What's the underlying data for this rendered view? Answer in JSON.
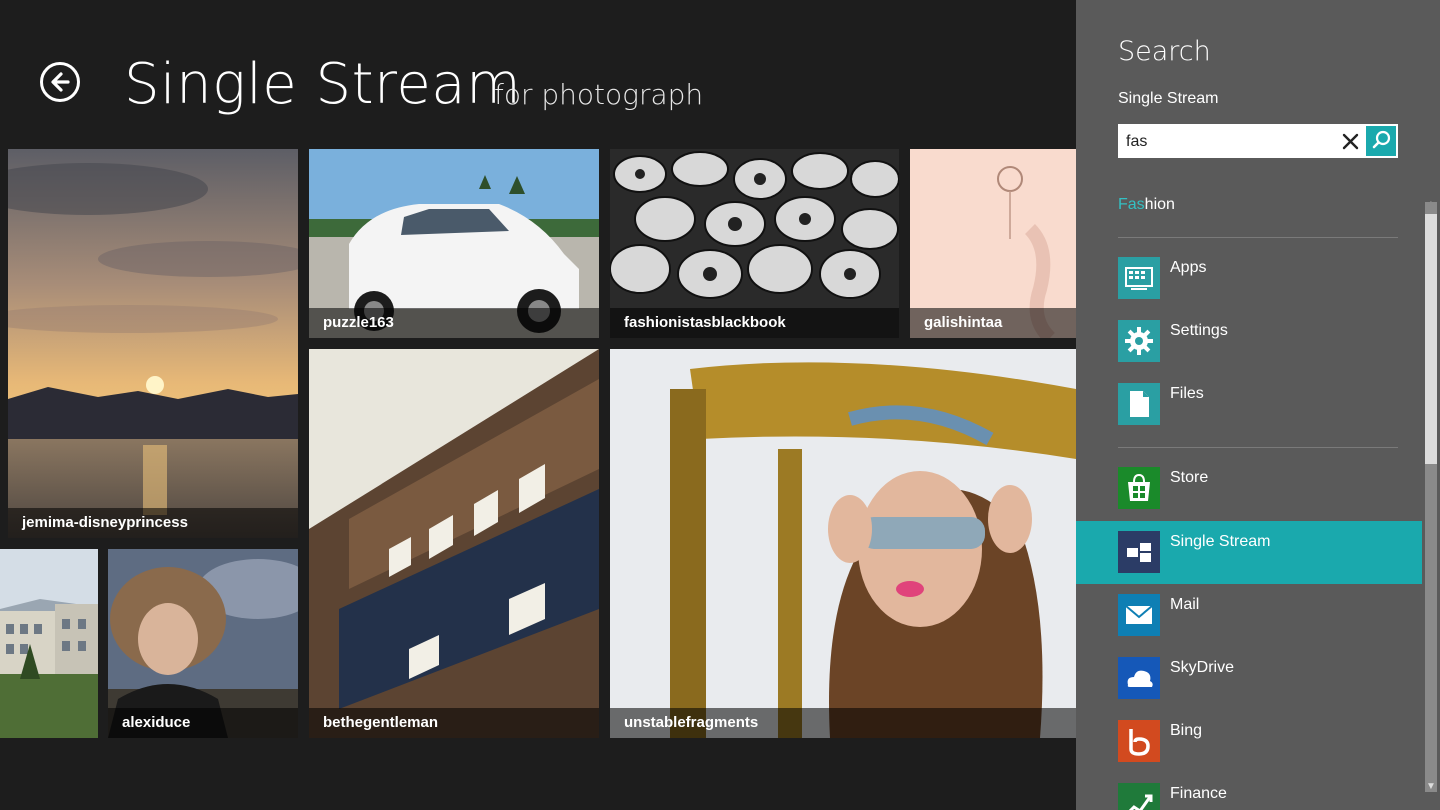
{
  "header": {
    "app_title": "Single Stream",
    "subtitle": "for photograph"
  },
  "tiles": [
    {
      "caption": "jemima-disneyprincess"
    },
    {
      "caption": "puzzle163"
    },
    {
      "caption": "fashionistasblackbook"
    },
    {
      "caption": "galishintaa"
    },
    {
      "caption": ""
    },
    {
      "caption": "alexiduce"
    },
    {
      "caption": "bethegentleman"
    },
    {
      "caption": "unstablefragments"
    }
  ],
  "search": {
    "title": "Search",
    "scope": "Single Stream",
    "query": "fas",
    "suggestion_match": "Fas",
    "suggestion_rest": "hion"
  },
  "apps": [
    {
      "label": "Apps",
      "icon": "apps-icon",
      "color": "#2a9fa3"
    },
    {
      "label": "Settings",
      "icon": "gear-icon",
      "color": "#2a9fa3"
    },
    {
      "label": "Files",
      "icon": "file-icon",
      "color": "#2a9fa3"
    },
    {
      "label": "Store",
      "icon": "store-icon",
      "color": "#1a8a2a"
    },
    {
      "label": "Single Stream",
      "icon": "single-stream-icon",
      "color": "#2b3c66",
      "selected": true
    },
    {
      "label": "Mail",
      "icon": "mail-icon",
      "color": "#0e7fb4"
    },
    {
      "label": "SkyDrive",
      "icon": "cloud-icon",
      "color": "#1558b8"
    },
    {
      "label": "Bing",
      "icon": "bing-icon",
      "color": "#d24a1f"
    },
    {
      "label": "Finance",
      "icon": "finance-icon",
      "color": "#1f7a3a"
    }
  ],
  "colors": {
    "accent": "#1aa9ad",
    "charm_bg": "#5a5a5a",
    "app_bg": "#1d1d1d"
  }
}
